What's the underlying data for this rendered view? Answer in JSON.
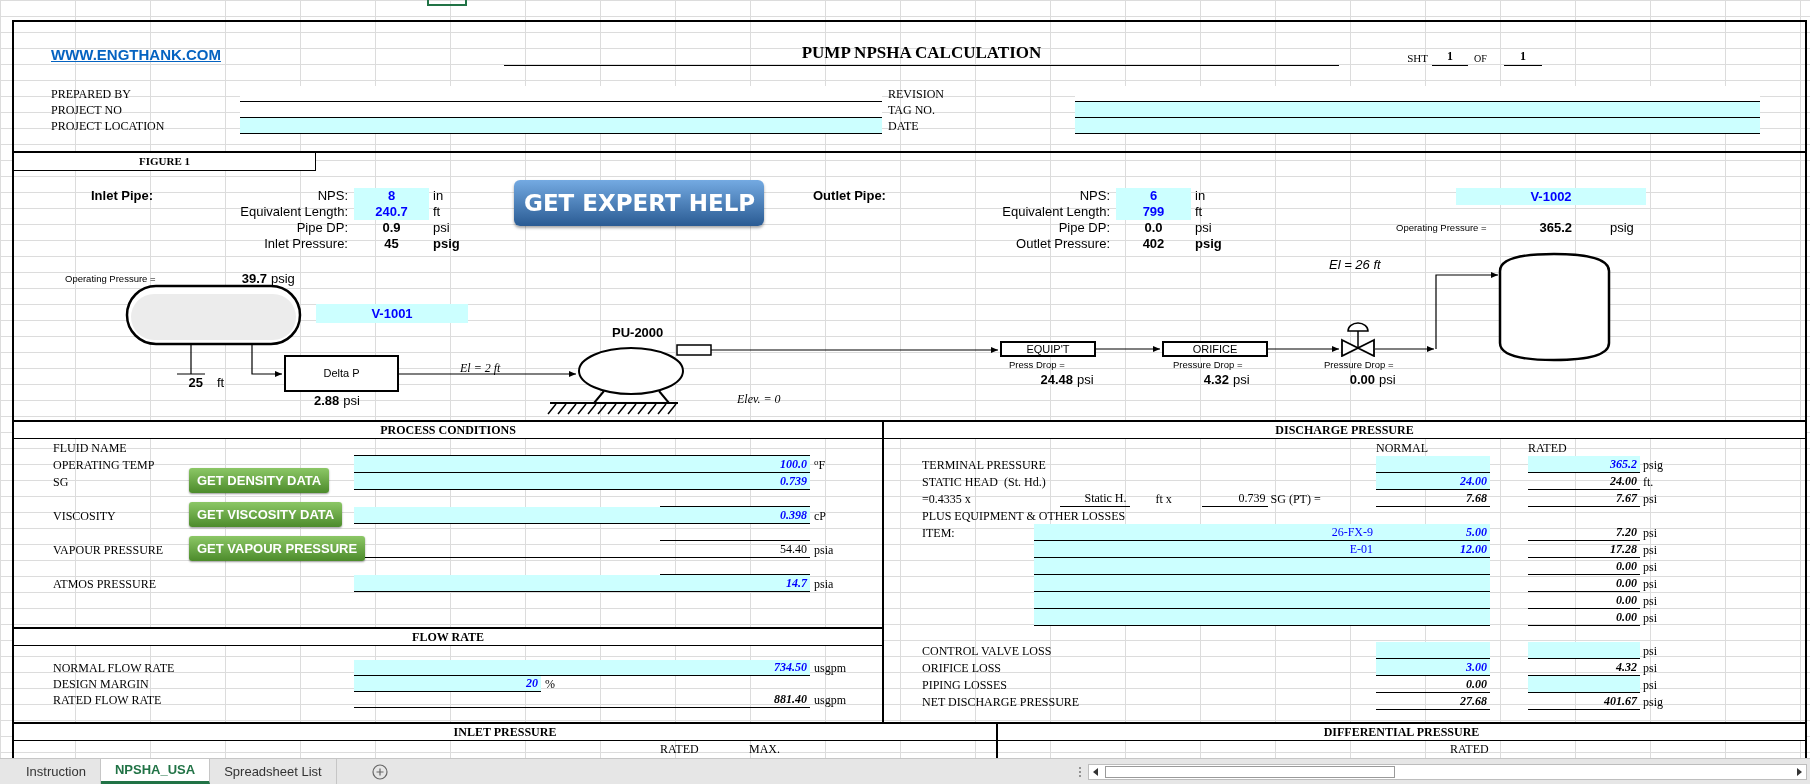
{
  "header": {
    "link": "WWW.ENGTHANK.COM",
    "title": "PUMP NPSHA CALCULATION",
    "sheet": {
      "label": "SHT",
      "number": "1",
      "of_label": "OF",
      "total": "1"
    }
  },
  "info": {
    "left": [
      {
        "label": "PREPARED BY",
        "input": false
      },
      {
        "label": "PROJECT NO",
        "input": false
      },
      {
        "label": "PROJECT LOCATION",
        "input": true
      }
    ],
    "right": [
      {
        "label": "REVISION",
        "input": false
      },
      {
        "label": "TAG NO.",
        "input": true
      },
      {
        "label": "DATE",
        "input": true
      }
    ]
  },
  "figure": {
    "title": "FIGURE 1",
    "inlet": {
      "heading": "Inlet Pipe:",
      "rows": [
        {
          "label": "NPS:",
          "value": "8",
          "unit": "in",
          "kind": "input"
        },
        {
          "label": "Equivalent Length:",
          "value": "240.7",
          "unit": "ft",
          "kind": "input"
        },
        {
          "label": "Pipe DP:",
          "value": "0.9",
          "unit": "psi",
          "kind": "result"
        },
        {
          "label": "Inlet Pressure:",
          "value": "45",
          "unit": "psig",
          "kind": "pressure"
        }
      ]
    },
    "expert_button": "GET EXPERT HELP",
    "outlet": {
      "heading": "Outlet Pipe:",
      "rows": [
        {
          "label": "NPS:",
          "value": "6",
          "unit": "in",
          "kind": "input"
        },
        {
          "label": "Equivalent Length:",
          "value": "799",
          "unit": "ft",
          "kind": "input"
        },
        {
          "label": "Pipe DP:",
          "value": "0.0",
          "unit": "psi",
          "kind": "result"
        },
        {
          "label": "Outlet Pressure:",
          "value": "402",
          "unit": "psig",
          "kind": "pressure"
        }
      ]
    },
    "suction_vessel": {
      "tag": "V-1001",
      "pressure_label": "Operating Pressure =",
      "pressure": "39.7",
      "pressure_unit": "psig",
      "level": "25",
      "level_unit": "ft"
    },
    "delta_p": {
      "label": "Delta P",
      "value": "2.88",
      "unit": "psi"
    },
    "suction_elevation": "El = 2 ft",
    "pump": {
      "tag": "PU-2000",
      "elevation": "Elev. = 0"
    },
    "equipment": [
      {
        "kind": "box",
        "label": "EQUIP'T",
        "drop_label": "Press Drop =",
        "value": "24.48",
        "unit": "psi"
      },
      {
        "kind": "box",
        "label": "ORIFICE",
        "drop_label": "Pressure Drop =",
        "value": "4.32",
        "unit": "psi"
      },
      {
        "kind": "valve",
        "drop_label": "Pressure Drop =",
        "value": "0.00",
        "unit": "psi"
      }
    ],
    "discharge_elevation": "El = 26 ft",
    "discharge_vessel": {
      "tag": "V-1002",
      "pressure_label": "Operating Pressure =",
      "pressure": "365.2",
      "pressure_unit": "psig"
    }
  },
  "process": {
    "title": "PROCESS CONDITIONS",
    "rows": [
      {
        "label": "FLUID NAME",
        "kind": "label"
      },
      {
        "label": "OPERATING TEMP",
        "value": "100.0",
        "unit": "$^{o}$F",
        "kind": "input"
      },
      {
        "label": "SG",
        "value": "0.739",
        "kind": "input",
        "button": "GET DENSITY DATA"
      },
      {
        "label": "VISCOSITY",
        "value": "0.398",
        "unit": "cP",
        "kind": "input",
        "button": "GET VISCOSITY DATA"
      },
      {
        "label": "VAPOUR PRESSURE",
        "value": "54.40",
        "unit": "psia",
        "kind": "calc",
        "button": "GET VAPOUR PRESSURE"
      },
      {
        "label": "ATMOS PRESSURE",
        "value": "14.7",
        "unit": "psia",
        "kind": "input"
      }
    ]
  },
  "flow": {
    "title": "FLOW RATE",
    "rows": [
      {
        "label": "NORMAL FLOW RATE",
        "value": "734.50",
        "unit": "usgpm",
        "kind": "input"
      },
      {
        "label": "DESIGN MARGIN",
        "value": "20",
        "unit": "%",
        "kind": "percent"
      },
      {
        "label": "RATED FLOW RATE",
        "value": "881.40",
        "unit": "usgpm",
        "kind": "result"
      }
    ]
  },
  "discharge": {
    "title": "DISCHARGE PRESSURE",
    "columns": [
      "NORMAL",
      "RATED"
    ],
    "rows": [
      {
        "kind": "value",
        "label": "TERMINAL PRESSURE",
        "normal": {
          "input": true
        },
        "rated": {
          "value": "365.2",
          "input": true
        },
        "unit": "psig"
      },
      {
        "kind": "value",
        "label": "STATIC HEAD  (St. Hd.)",
        "normal": {
          "value": "24.00",
          "input": true
        },
        "rated": {
          "value": "24.00",
          "input": false
        },
        "unit": "ft."
      },
      {
        "kind": "formula",
        "factor": "=0.4335 x",
        "head_label": "Static H.",
        "head_unit": "ft x",
        "sg": "0.739",
        "sg_label": "SG (PT) =",
        "normal": {
          "value": "7.68",
          "input": false
        },
        "rated": {
          "value": "7.67",
          "input": false
        },
        "unit": "psi"
      },
      {
        "kind": "heading",
        "label": "PLUS EQUIPMENT & OTHER LOSSES"
      },
      {
        "kind": "item",
        "label": "ITEM:",
        "item": "26-FX-9",
        "normal": {
          "value": "5.00",
          "input": true
        },
        "rated": {
          "value": "7.20",
          "input": false
        },
        "unit": "psi"
      },
      {
        "kind": "item",
        "item": "E-01",
        "normal": {
          "value": "12.00",
          "input": true
        },
        "rated": {
          "value": "17.28",
          "input": false
        },
        "unit": "psi"
      },
      {
        "kind": "item",
        "normal": {
          "input": true
        },
        "rated": {
          "value": "0.00",
          "input": false
        },
        "unit": "psi"
      },
      {
        "kind": "item",
        "normal": {
          "input": true
        },
        "rated": {
          "value": "0.00",
          "input": false
        },
        "unit": "psi"
      },
      {
        "kind": "item",
        "normal": {
          "input": true
        },
        "rated": {
          "value": "0.00",
          "input": false
        },
        "unit": "psi"
      },
      {
        "kind": "item",
        "normal": {
          "input": true
        },
        "rated": {
          "value": "0.00",
          "input": false
        },
        "unit": "psi"
      },
      {
        "kind": "blank"
      },
      {
        "kind": "value",
        "label": "CONTROL VALVE LOSS",
        "normal": {
          "input": true
        },
        "rated": {
          "input": true
        },
        "unit": "psi"
      },
      {
        "kind": "value",
        "label": "ORIFICE LOSS",
        "normal": {
          "value": "3.00",
          "input": true
        },
        "rated": {
          "value": "4.32",
          "input": false
        },
        "unit": "psi"
      },
      {
        "kind": "value",
        "label": "PIPING LOSSES",
        "normal": {
          "value": "0.00",
          "input": false
        },
        "rated": {
          "input": true
        },
        "unit": "psi"
      },
      {
        "kind": "value",
        "label": "NET DISCHARGE PRESSURE",
        "normal": {
          "value": "27.68",
          "input": false
        },
        "rated": {
          "value": "401.67",
          "input": false
        },
        "unit": "psig"
      }
    ]
  },
  "inlet_pressure": {
    "title": "INLET PRESSURE",
    "columns": [
      "RATED",
      "MAX."
    ]
  },
  "differential_pressure": {
    "title": "DIFFERENTIAL PRESSURE",
    "columns": [
      "RATED"
    ]
  },
  "tabs": [
    {
      "label": "Instruction",
      "selected": false
    },
    {
      "label": "NPSHA_USA",
      "selected": true
    },
    {
      "label": "Spreadsheet List",
      "selected": false
    }
  ]
}
